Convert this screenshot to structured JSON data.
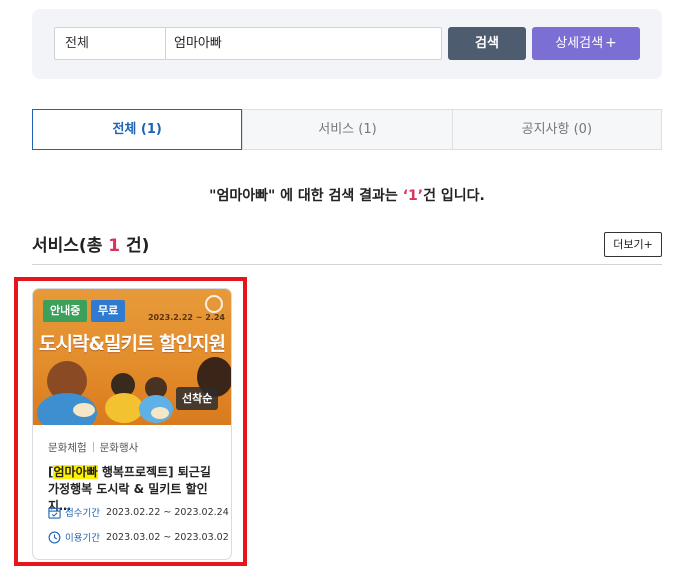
{
  "search": {
    "category": "전체",
    "query": "엄마아빠",
    "search_label": "검색",
    "advanced_label": "상세검색",
    "advanced_plus": "+"
  },
  "tabs": [
    {
      "label": "전체 (1)",
      "active": true
    },
    {
      "label": "서비스 (1)",
      "active": false
    },
    {
      "label": "공지사항 (0)",
      "active": false
    }
  ],
  "result": {
    "prefix": "\"엄마아빠\" 에 대한 검색 결과는 ",
    "count": "‘1’",
    "suffix": "건 입니다."
  },
  "section": {
    "title_prefix": "서비스(총 ",
    "count": "1",
    "title_suffix": " 건)",
    "more_label": "더보기+"
  },
  "card": {
    "badges": {
      "status": "안내중",
      "price": "무료",
      "order": "선착순"
    },
    "thumbnail_title": "도시락&밀키트 할인지원",
    "thumbnail_date": "2023.2.22 ~ 2.24",
    "category1": "문화체험",
    "category2": "문화행사",
    "title_highlight": "엄마아빠",
    "title_rest": " 행복프로젝트] 퇴근길 가정행복 도시락 & 밀키트 할인지…",
    "title_bracket": "[",
    "apply_label": "접수기간",
    "apply_period": "2023.02.22 ~ 2023.02.24",
    "use_label": "이용기간",
    "use_period": "2023.03.02 ~ 2023.03.02"
  },
  "colors": {
    "accent_blue": "#1f63b5",
    "accent_red": "#d6335f",
    "search_button": "#4d5c6e",
    "advanced_button": "#7b6fd6",
    "highlight_frame": "#e8141b"
  }
}
